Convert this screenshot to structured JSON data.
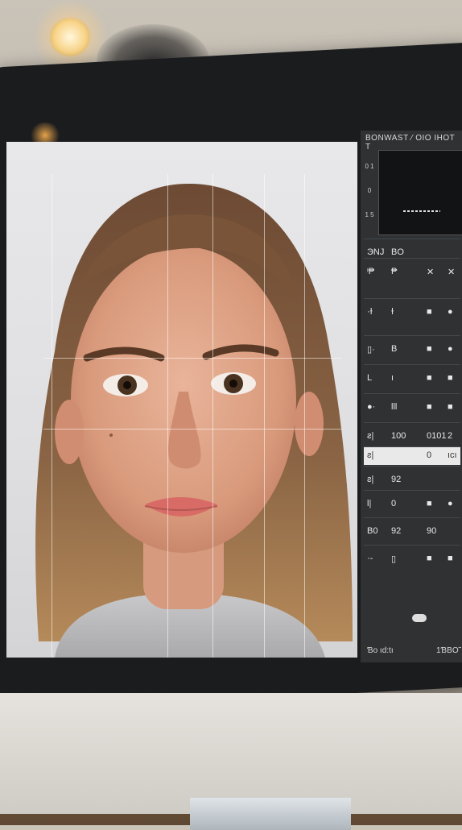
{
  "app": {
    "panel_title": "BONWAST ∕ OIO  IHOT T",
    "toolbar_text": "",
    "nav_rail": [
      "0 1",
      "0",
      "1 5"
    ],
    "rows": [
      {
        "l": "ЭNJ",
        "m": "BO",
        "r1": "",
        "r2": ""
      },
      {
        "l": "ᶦ₱",
        "m": "₱",
        "r1": "✕",
        "r2": "✕"
      },
      {
        "l": "·Ɨ",
        "m": "Ɨ",
        "r1": "■",
        "r2": "●"
      },
      {
        "l": "▯·",
        "m": "B",
        "r1": "■",
        "r2": "●"
      },
      {
        "l": "L",
        "m": "ı",
        "r1": "■",
        "r2": "■"
      },
      {
        "l": "●·",
        "m": "lll",
        "r1": "■",
        "r2": "■"
      },
      {
        "l": "ƨ|",
        "m": "100",
        "r1": "0101",
        "r2": "2"
      },
      {
        "l": "ƨ|",
        "m": "",
        "r1": "0",
        "r2": "ıcı"
      },
      {
        "l": "ƨ|",
        "m": "92",
        "r1": "",
        "r2": ""
      },
      {
        "l": "l|",
        "m": "0",
        "r1": "■",
        "r2": "●"
      },
      {
        "l": "B0",
        "m": "92",
        "r1": "90",
        "r2": ""
      },
      {
        "l": "·-",
        "m": "▯",
        "r1": "■",
        "r2": "■"
      }
    ],
    "footer_left": "Ɓo ıd:tı",
    "footer_right": "1ƁBO˜"
  }
}
